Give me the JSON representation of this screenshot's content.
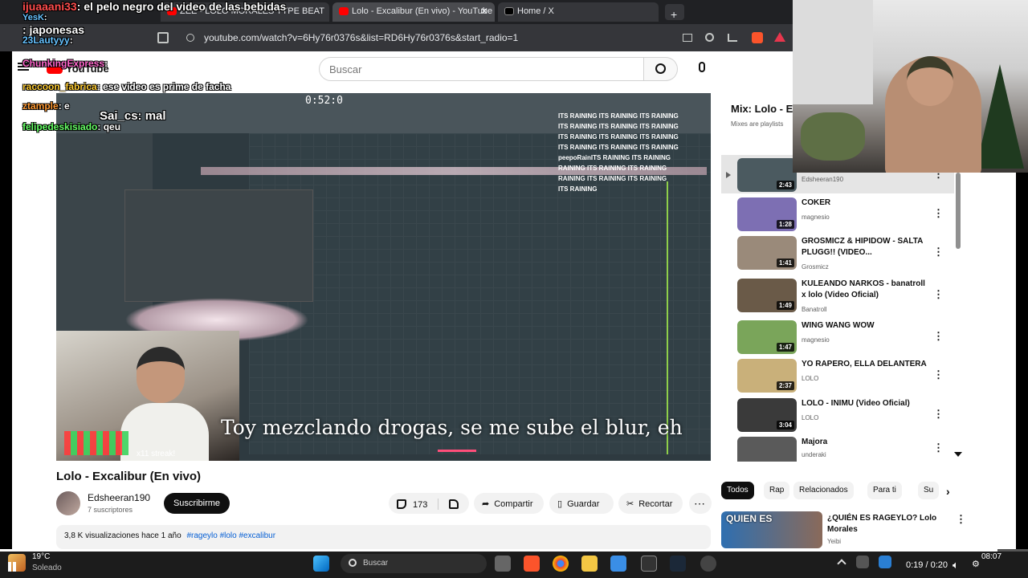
{
  "browser": {
    "tabs": [
      {
        "label": "ZEE - LOLO MORALES TYPE BEAT",
        "close": "✕"
      },
      {
        "label": "Lolo - Excalibur (En vivo) - YouTube",
        "close": "✕"
      },
      {
        "label": "Home / X",
        "close": ""
      }
    ],
    "new_tab": "+",
    "url": "youtube.com/watch?v=6Hy76r0376s&list=RD6Hy76r0376s&start_radio=1"
  },
  "youtube": {
    "logo": "YouTube",
    "search_placeholder": "Buscar",
    "video": {
      "title": "Lolo - Excalibur (En vivo)",
      "lyrics": "Toy mezclando drogas, se me sube el blur, eh",
      "streak": "x11 streak!",
      "timer": "0:52:0",
      "rain_lines": [
        "ITS RAINING ITS RAINING ITS RAINING",
        "ITS RAINING ITS RAINING ITS RAINING",
        "ITS RAINING ITS RAINING ITS RAINING",
        "ITS RAINING ITS RAINING ITS RAINING",
        "peepoRainITS RAINING ITS RAINING",
        "RAINING ITS RAINING ITS RAINING",
        "RAINING ITS RAINING ITS RAINING",
        "ITS RAINING"
      ]
    },
    "channel": {
      "name": "Edsheeran190",
      "subs": "7 suscriptores",
      "subscribe": "Suscribirme"
    },
    "actions": {
      "likes": "173",
      "share": "Compartir",
      "save": "Guardar",
      "clip": "Recortar",
      "more": "⋯"
    },
    "description": {
      "meta": "3,8 K visualizaciones  hace 1 año",
      "tags": "#rageylo #lolo #excalibur"
    },
    "mix": {
      "title": "Mix: Lolo - E",
      "subtitle": "Mixes are playlists"
    },
    "playlist": [
      {
        "title": "",
        "channel": "Edsheeran190",
        "duration": "2:43",
        "color": "#4b5a60"
      },
      {
        "title": "COKER",
        "channel": "magnesio",
        "duration": "1:28",
        "color": "#7d6fb3"
      },
      {
        "title": "GROSMICZ & HIPIDOW - SALTA PLUGG!! (VIDEO...",
        "channel": "Grosmicz",
        "duration": "1:41",
        "color": "#9a8a7a"
      },
      {
        "title": "KULEANDO NARKOS - banatroll x lolo (Video Oficial)",
        "channel": "Banatroll",
        "duration": "1:49",
        "color": "#6a5a48"
      },
      {
        "title": "WING WANG WOW",
        "channel": "magnesio",
        "duration": "1:47",
        "color": "#7aa55a"
      },
      {
        "title": "YO RAPERO, ELLA DELANTERA",
        "channel": "LOLO",
        "duration": "2:37",
        "color": "#c9b07a"
      },
      {
        "title": "LOLO - INIMU (Video Oficial)",
        "channel": "LOLO",
        "duration": "3:04",
        "color": "#3a3a3a"
      },
      {
        "title": "Majora",
        "channel": "underaki",
        "duration": "",
        "color": "#5a5a5a"
      }
    ],
    "chips": [
      "Todos",
      "Rap",
      "Relacionados",
      "Para ti",
      "Su"
    ],
    "recommended": {
      "title": "¿QUIÉN ES RAGEYLO? Lolo Morales",
      "thumb_text": "QUIEN ES",
      "channel": "Yeibi"
    }
  },
  "chat": [
    {
      "user": "ijuaaani33",
      "text": ": el pelo negro del video de las bebidas",
      "color": "#ff4d4d"
    },
    {
      "user": "YesK",
      "text": ": japonesas",
      "color": "#66c2ff"
    },
    {
      "user": "23Lautyyy",
      "text": ":",
      "color": "#66c2ff"
    },
    {
      "user": "ChunkingExpress",
      "text": ":",
      "color": "#ff66cc"
    },
    {
      "user": "raccoon_fabrica",
      "text": ": ese video es prime de facha",
      "color": "#ffcc33"
    },
    {
      "user": "ztample",
      "text": ": e",
      "color": "#ff9933"
    },
    {
      "user": "Sai_cs",
      "text": ": mal",
      "color": "#ffffff"
    },
    {
      "user": "felipedeskisiado",
      "text": ": qeu",
      "color": "#66ff66"
    }
  ],
  "taskbar": {
    "weather_temp": "19°C",
    "weather_desc": "Soleado",
    "search": "Buscar",
    "time": "08:07",
    "video_time": "0:19 / 0:20"
  }
}
